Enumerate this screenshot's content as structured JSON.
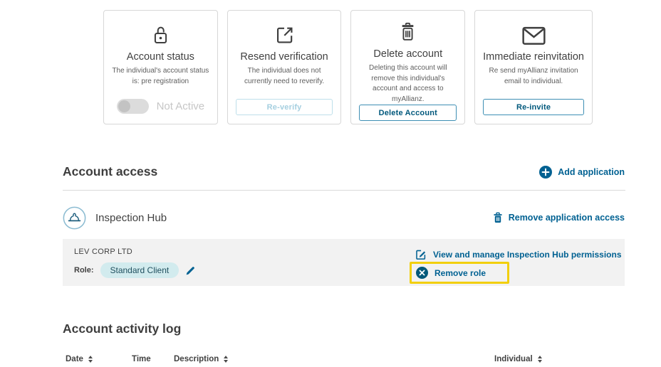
{
  "brand_colors": {
    "accent_blue": "#006192",
    "highlight_yellow": "#F2CF0C",
    "pill_teal_bg": "#D2EBEE",
    "icon_charcoal": "#3F3F3F",
    "row_gray_bg": "#F2F2F2"
  },
  "cards": [
    {
      "icon": "unlock-icon",
      "title": "Account status",
      "body": "The individual's account status is: pre registration",
      "control_type": "toggle",
      "control_label": "Not Active",
      "toggle_state": "off"
    },
    {
      "icon": "external-link-icon",
      "title": "Resend verification",
      "body": "The individual does not currently need to reverify.",
      "control_type": "button-disabled",
      "control_label": "Re-verify"
    },
    {
      "icon": "trash-icon",
      "title": "Delete account",
      "body": "Deleting this account will remove this individual's account and access to myAllianz.",
      "control_type": "button",
      "control_label": "Delete Account"
    },
    {
      "icon": "mail-icon",
      "title": "Immediate reinvitation",
      "body": "Re send myAllianz invitation email to individual.",
      "control_type": "button",
      "control_label": "Re-invite"
    }
  ],
  "account_access": {
    "heading": "Account access",
    "add_application_label": "Add application",
    "application": {
      "icon": "hard-hat-icon",
      "name": "Inspection Hub",
      "remove_access_label": "Remove application access"
    },
    "organisation": {
      "name": "LEV CORP LTD",
      "role_label": "Role:",
      "role_value": "Standard Client",
      "manage_permissions_label": "View and manage Inspection Hub permissions",
      "remove_role_label": "Remove role"
    }
  },
  "activity_log": {
    "heading": "Account activity log",
    "columns": [
      {
        "label": "Date",
        "sortable": true
      },
      {
        "label": "Time",
        "sortable": false
      },
      {
        "label": "Description",
        "sortable": true
      },
      {
        "label": "Individual",
        "sortable": true
      }
    ]
  }
}
